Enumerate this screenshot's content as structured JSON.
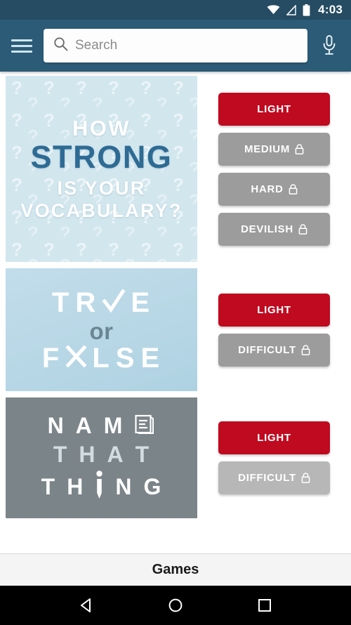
{
  "status_bar": {
    "time": "4:03",
    "icons": [
      "wifi-icon",
      "no-signal-icon",
      "battery-icon"
    ]
  },
  "app_bar": {
    "menu_icon": "hamburger-menu-icon",
    "search": {
      "icon": "search-icon",
      "value": "",
      "placeholder": "Search"
    },
    "mic_icon": "microphone-icon",
    "background": "#2b5b76"
  },
  "colors": {
    "status_bar": "#254c63",
    "app_bar": "#2b5b76",
    "primary_button": "#bf0a20",
    "locked_button": "#9c9c9c",
    "card1_bg": "#d2e6ee",
    "card2_bg": "#b8d7e6",
    "card3_bg": "#7b8489",
    "strong_text": "#2e6b94"
  },
  "cards": [
    {
      "id": "vocabulary-quiz",
      "art": {
        "pattern": "question-mark-pattern",
        "lines": [
          {
            "text": "HOW",
            "style": "white-small"
          },
          {
            "text": "STRONG",
            "style": "blue-large"
          },
          {
            "text": "IS YOUR",
            "style": "white-medium"
          },
          {
            "text": "VOCABULARY?",
            "style": "white-medium"
          }
        ]
      },
      "buttons": [
        {
          "label": "LIGHT",
          "state": "unlocked",
          "locked": false
        },
        {
          "label": "MEDIUM",
          "state": "locked",
          "locked": true
        },
        {
          "label": "HARD",
          "state": "locked",
          "locked": true
        },
        {
          "label": "DEVILISH",
          "state": "locked",
          "locked": true
        }
      ]
    },
    {
      "id": "true-or-false-quiz",
      "art": {
        "line1": [
          "T",
          "R",
          "check-icon",
          "E"
        ],
        "line2": "or",
        "line3": [
          "F",
          "cross-icon",
          "L",
          "S",
          "E"
        ]
      },
      "buttons": [
        {
          "label": "LIGHT",
          "state": "unlocked",
          "locked": false
        },
        {
          "label": "DIFFICULT",
          "state": "locked",
          "locked": true
        }
      ]
    },
    {
      "id": "name-that-thing-quiz",
      "art": {
        "line1": [
          "N",
          "A",
          "M",
          "book-icon-E"
        ],
        "line2": [
          "T",
          "H",
          "A",
          "T"
        ],
        "line3": [
          "T",
          "H",
          "pencil-icon-I",
          "N",
          "G"
        ]
      },
      "buttons": [
        {
          "label": "LIGHT",
          "state": "unlocked",
          "locked": false
        },
        {
          "label": "DIFFICULT",
          "state": "locked",
          "locked": true
        }
      ]
    }
  ],
  "bottom_bar": {
    "label": "Games"
  },
  "nav_bar": {
    "back": "back-triangle-icon",
    "home": "home-circle-icon",
    "recents": "recents-square-icon"
  }
}
